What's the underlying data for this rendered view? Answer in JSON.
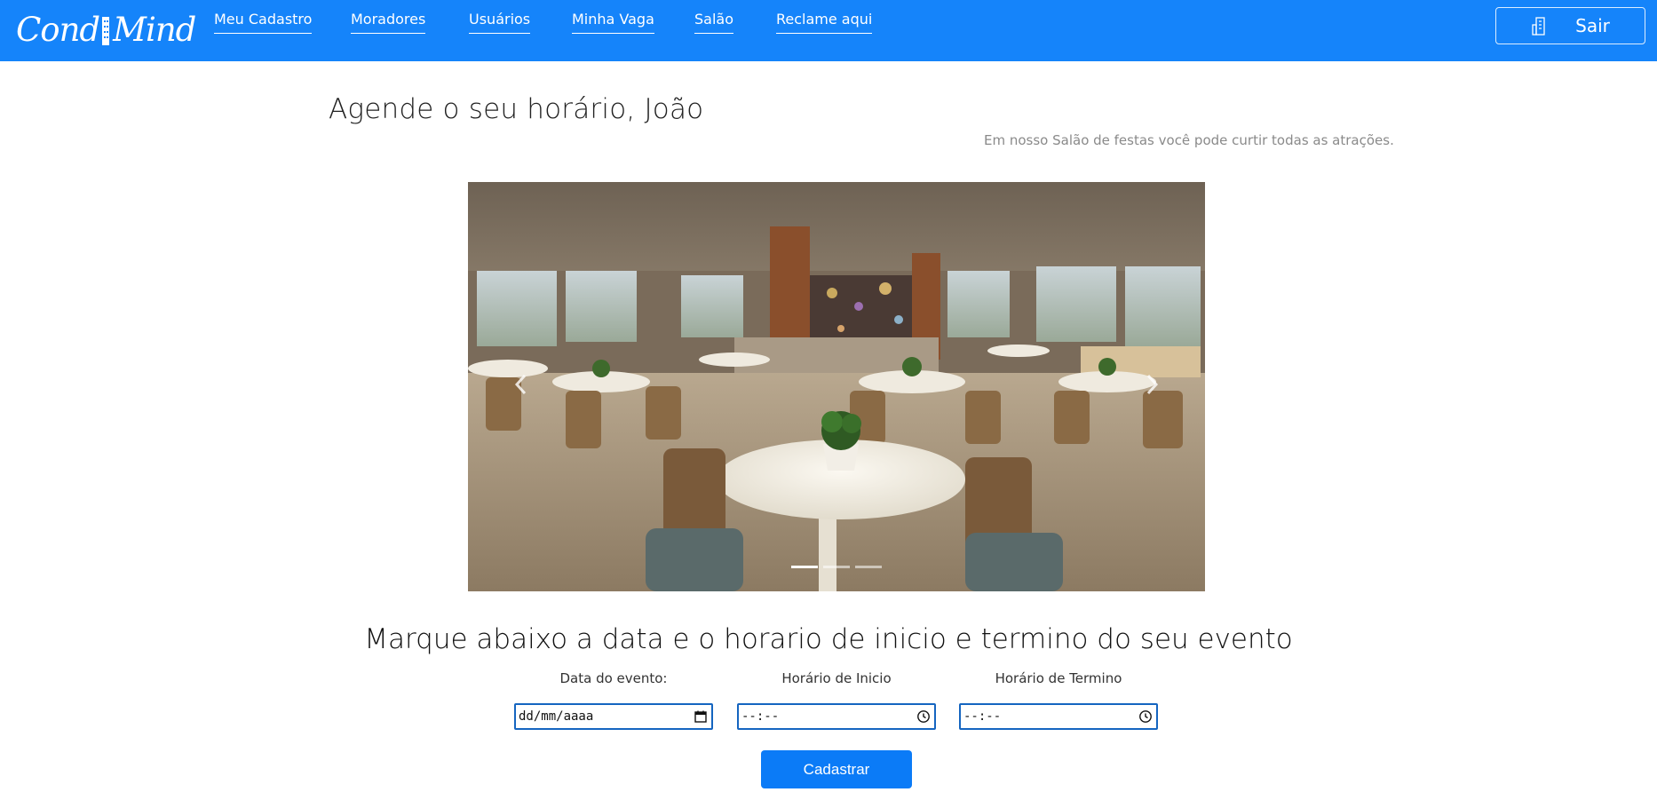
{
  "brand": {
    "logo_part1": "Cond",
    "logo_part2": "Mind",
    "color": "#1584fa"
  },
  "nav": {
    "items": [
      {
        "label": "Meu Cadastro"
      },
      {
        "label": "Moradores"
      },
      {
        "label": "Usuários"
      },
      {
        "label": "Minha Vaga"
      },
      {
        "label": "Salão"
      },
      {
        "label": "Reclame aqui"
      }
    ],
    "logout_label": "Sair",
    "logout_icon": "building-icon"
  },
  "page": {
    "title": "Agende o seu horário, João",
    "subtitle": "Em nosso Salão de festas você pode curtir todas as atrações."
  },
  "carousel": {
    "slide_count": 3,
    "active_index": 0,
    "prev_icon": "chevron-left-icon",
    "next_icon": "chevron-right-icon"
  },
  "form": {
    "heading": "Marque abaixo a data e o horario de inicio e termino do seu evento",
    "date_label": "Data do evento:",
    "date_placeholder": "dd/mm/aaaa",
    "start_label": "Horário de Inicio",
    "start_placeholder": "--:--",
    "end_label": "Horário de Termino",
    "end_placeholder": "--:--",
    "submit_label": "Cadastrar",
    "submit_color": "#0b7bf7"
  }
}
